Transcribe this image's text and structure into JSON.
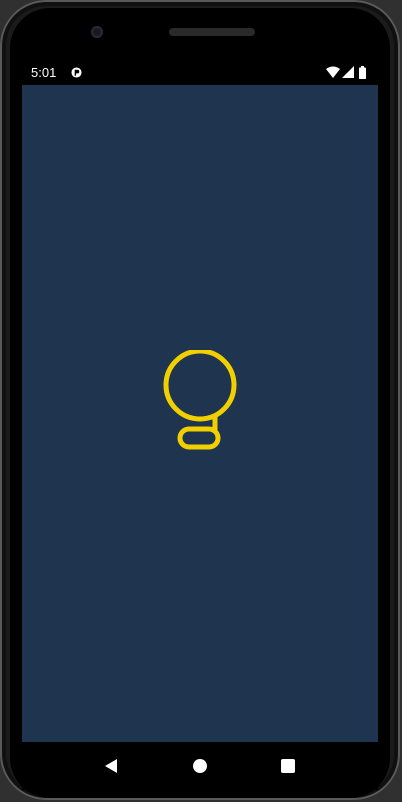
{
  "device": {
    "frame_color": "#1b1b1b",
    "screen_color": "#1e344f"
  },
  "status_bar": {
    "time": "5:01",
    "icons": [
      "app-notification-icon",
      "wifi-icon",
      "cellular-signal-icon",
      "battery-icon"
    ]
  },
  "main": {
    "icon": "lightbulb-icon",
    "icon_color": "#f2d000"
  },
  "nav_bar": {
    "buttons": [
      "back-icon",
      "home-icon",
      "recents-icon"
    ]
  }
}
